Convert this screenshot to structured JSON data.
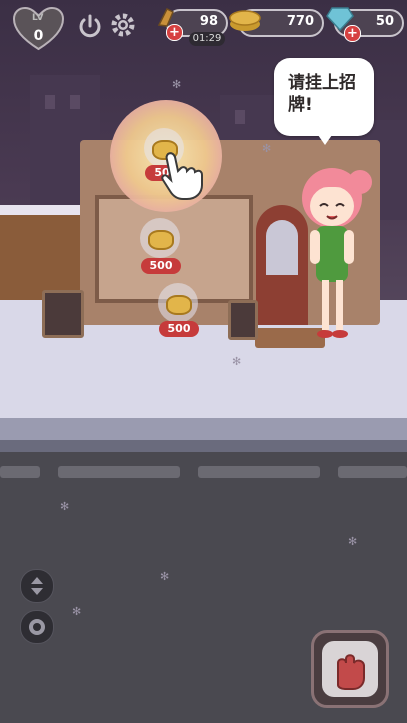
{
  "hud": {
    "level_label": "LV",
    "level_value": "0",
    "energy_value": "98",
    "energy_timer": "01:29",
    "coins_value": "770",
    "gems_value": "50",
    "plus_symbol": "+"
  },
  "speech_bubble": {
    "text": "请挂上招牌!"
  },
  "prices": {
    "spotlight_price": "50",
    "stand_price": "500",
    "floor_price": "500"
  },
  "icons": {
    "level": "heart-shield-icon",
    "power": "power-icon",
    "settings": "gear-icon",
    "energy": "energy-icon",
    "coins": "coin-stack-icon",
    "gems": "gem-icon",
    "camera_toggle": "up-down-arrows-icon",
    "view": "eye-icon",
    "action": "glove-icon",
    "tutorial": "pointing-hand-icon"
  },
  "colors": {
    "accent_red": "#c63b3b",
    "coin_gold": "#e2b54a",
    "apron_green": "#4f9a3e",
    "hair_pink": "#f28a9a"
  }
}
